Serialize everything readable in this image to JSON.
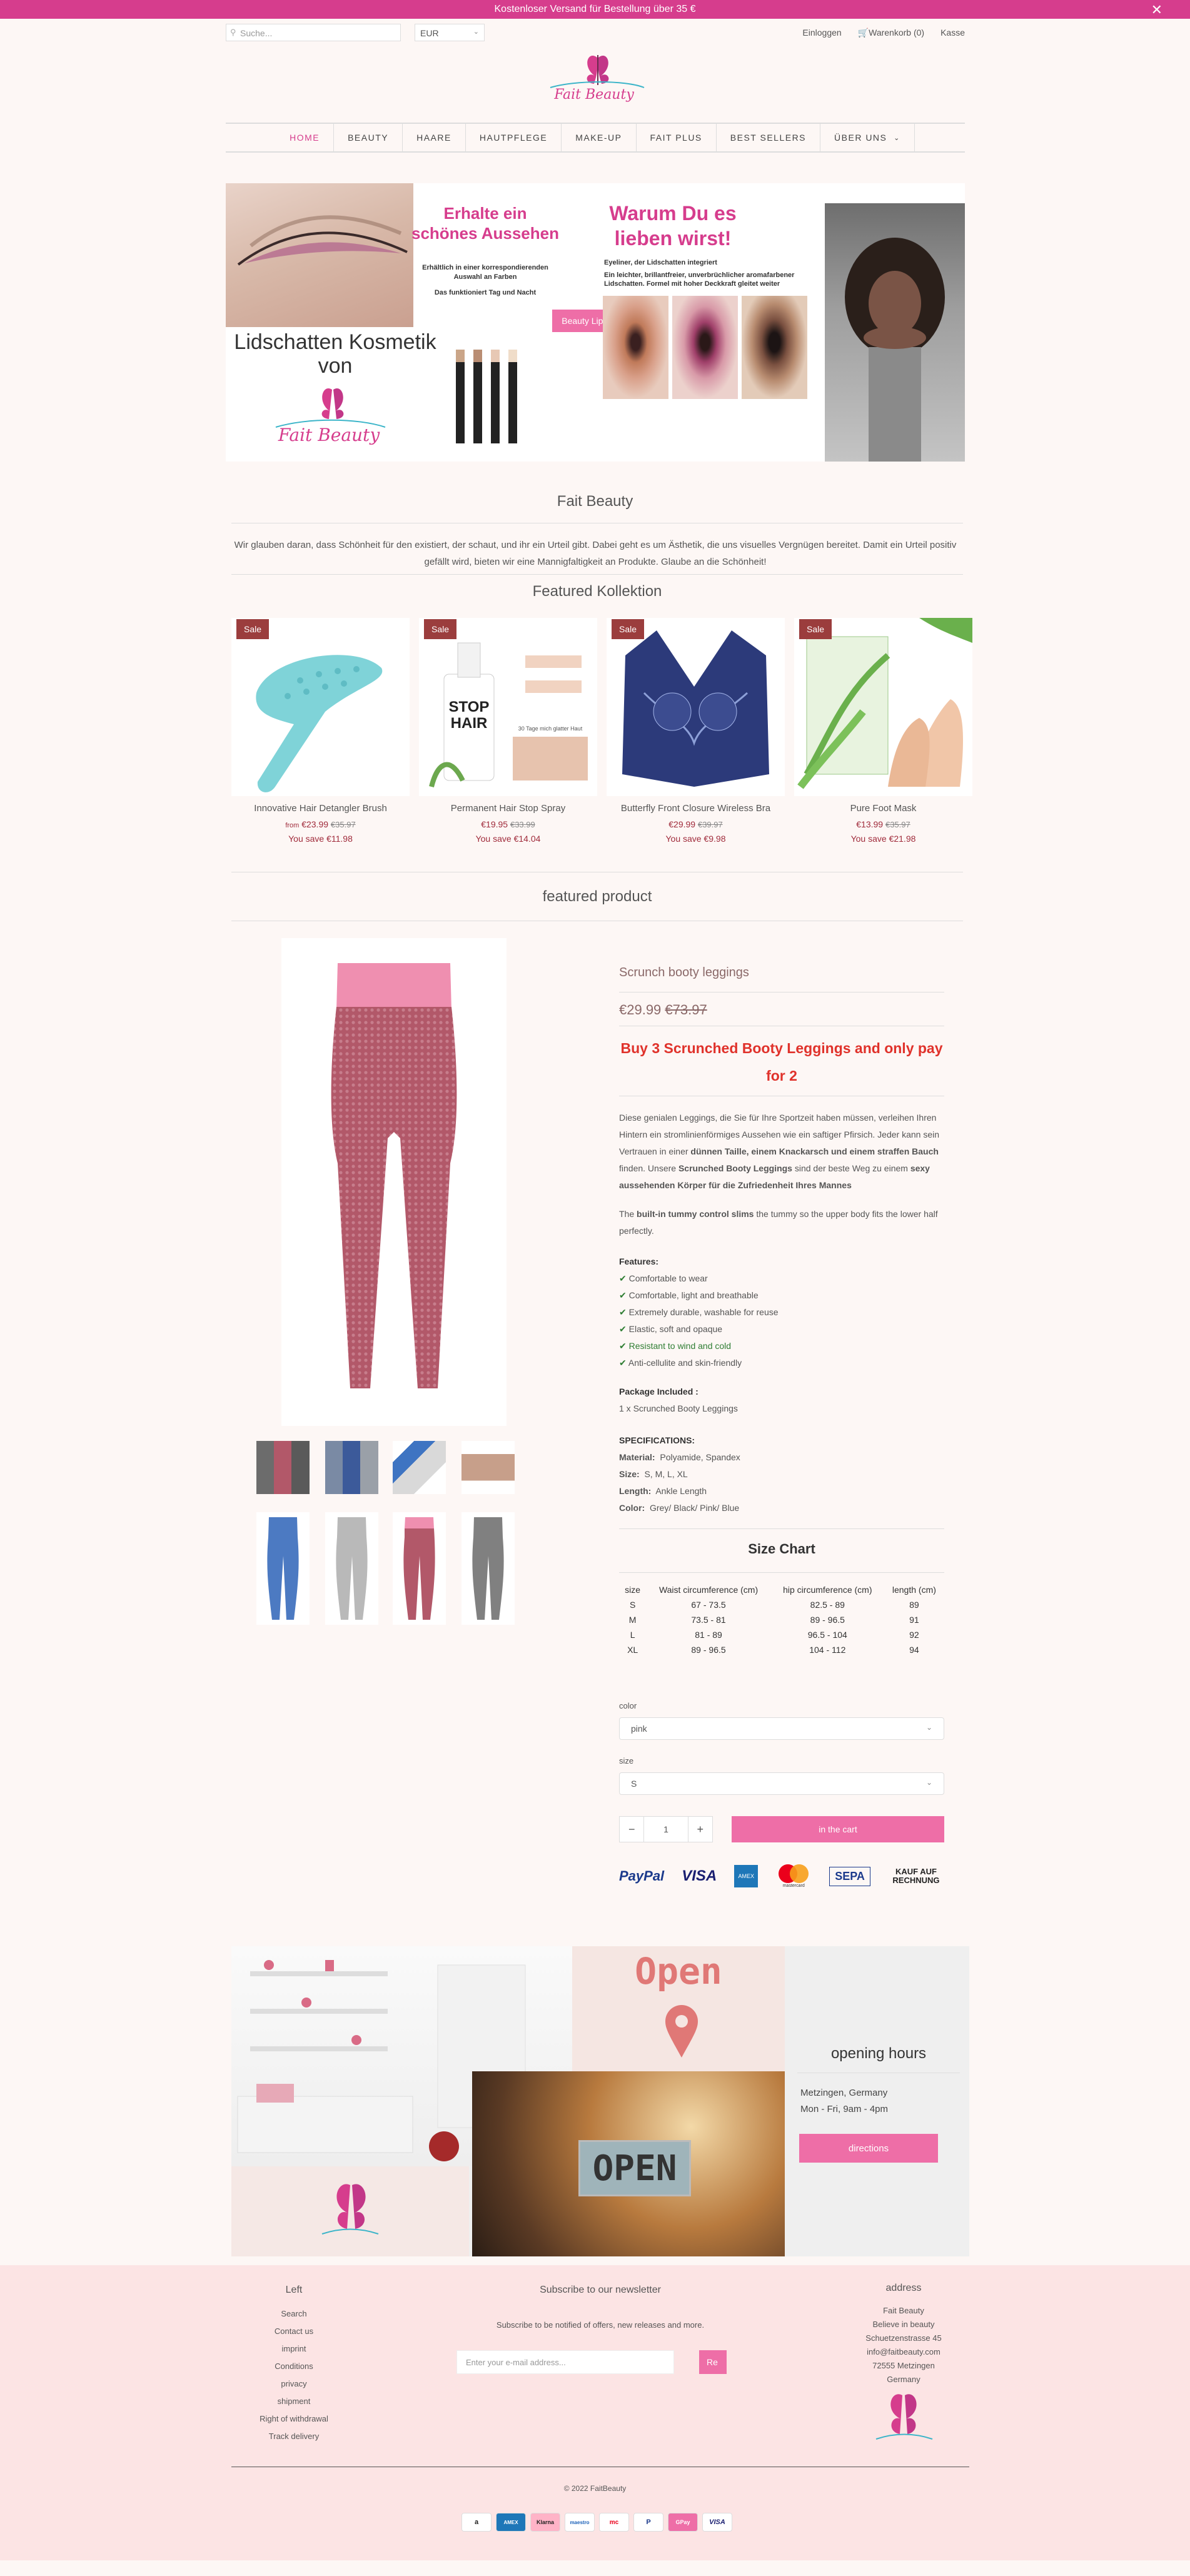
{
  "announcement": "Kostenloser Versand für Bestellung über 35 €",
  "search": {
    "placeholder": "Suche..."
  },
  "currency": "EUR",
  "toplinks": {
    "login": "Einloggen",
    "cart": "Warenkorb (0)",
    "checkout": "Kasse"
  },
  "logo": "Fait Beauty",
  "nav": [
    "HOME",
    "BEAUTY",
    "HAARE",
    "HAUTPFLEGE",
    "MAKE-UP",
    "FAIT PLUS",
    "BEST SELLERS",
    "ÜBER UNS"
  ],
  "banner": {
    "h1": "Erhalte ein",
    "h2": "schönes Aussehen",
    "sub1": "Erhältlich in einer korrespondierenden",
    "sub2": "Auswahl an Farben",
    "sub3": "Das funktioniert Tag und Nacht",
    "lid1": "Lidschatten Kosmetik",
    "lid2": "von",
    "w1": "Warum Du es",
    "w2": "lieben wirst!",
    "d1": "Eyeliner, der Lidschatten integriert",
    "d2": "Ein leichter, brillantfreier, unverbrüchlicher aromafarbener",
    "d3": "Lidschatten. Formel mit hoher Deckkraft gleitet weiter",
    "button": "Beauty Lippen"
  },
  "about": {
    "title": "Fait Beauty",
    "text1": "Wir glauben daran, dass Schönheit für den existiert, der schaut, und ihr ein Urteil gibt. Dabei geht es um Ästhetik, die uns visuelles Vergnügen bereitet. Damit ein Urteil positiv",
    "text2": "gefällt wird, bieten wir eine Mannigfaltigkeit an Produkte. Glaube an die Schönheit!"
  },
  "featured_title": "Featured Kollektion",
  "products": [
    {
      "sale": "Sale",
      "name": "Innovative Hair Detangler Brush",
      "from": "from",
      "price": "€23.99",
      "old": "€35.97",
      "save": "You save €11.98"
    },
    {
      "sale": "Sale",
      "name": "Permanent Hair Stop Spray",
      "from": "",
      "price": "€19.95",
      "old": "€33.99",
      "save": "You save €14.04"
    },
    {
      "sale": "Sale",
      "name": "Butterfly Front Closure Wireless Bra",
      "from": "",
      "price": "€29.99",
      "old": "€39.97",
      "save": "You save €9.98"
    },
    {
      "sale": "Sale",
      "name": "Pure Foot Mask",
      "from": "",
      "price": "€13.99",
      "old": "€35.97",
      "save": "You save €21.98"
    }
  ],
  "spray_text": "STOP HAIR",
  "spray_note": "30 Tage mich glatter Haut",
  "fp": {
    "section_title": "featured product",
    "name": "Scrunch booty leggings",
    "price": "€29.99",
    "old": "€73.97",
    "promo": "Buy 3 Scrunched Booty Leggings and only pay for 2",
    "p1": "Diese genialen Leggings, die Sie für Ihre Sportzeit haben müssen, verleihen Ihren Hintern ein stromlinienförmiges Aussehen wie ein saftiger Pfirsich. Jeder kann sein Vertrauen in einer",
    "p1b": "dünnen Taille, einem Knackarsch und einem straffen Bauch",
    "p1c": "finden. Unsere",
    "p1d": "Scrunched Booty Leggings",
    "p1e": "sind der beste Weg zu einem",
    "p1f": "sexy aussehenden Körper für die Zufriedenheit Ihres Mannes",
    "p2a": "The",
    "p2b": "built-in tummy control slims",
    "p2c": "the tummy so the upper body fits the lower half perfectly.",
    "features_label": "Features:",
    "features": [
      "Comfortable  to wear",
      "Comfortable, light and breathable",
      "Extremely durable, washable for reuse",
      "Elastic, soft and opaque",
      "Resistant to  wind and cold",
      "Anti-cellulite and skin-friendly"
    ],
    "pkg_label": "Package Included :",
    "pkg": "1 x Scrunched Booty Leggings",
    "spec_label": "SPECIFICATIONS:",
    "specs": [
      {
        "k": "Material:",
        "v": "Polyamide, Spandex"
      },
      {
        "k": "Size:",
        "v": "S, M, L, XL"
      },
      {
        "k": "Length:",
        "v": "Ankle Length"
      },
      {
        "k": "Color:",
        "v": "Grey/ Black/ Pink/ Blue"
      }
    ],
    "size_chart_title": "Size Chart",
    "size_head": [
      "size",
      "Waist circumference (cm)",
      "hip circumference (cm)",
      "length (cm)"
    ],
    "size_rows": [
      [
        "S",
        "67 - 73.5",
        "82.5 - 89",
        "89"
      ],
      [
        "M",
        "73.5 - 81",
        "89 - 96.5",
        "91"
      ],
      [
        "L",
        "81 - 89",
        "96.5 - 104",
        "92"
      ],
      [
        "XL",
        "89 - 96.5",
        "104 - 112",
        "94"
      ]
    ],
    "color_label": "color",
    "color_value": "pink",
    "size_label": "size",
    "size_value": "S",
    "qty": "1",
    "minus": "−",
    "plus": "+",
    "cart_button": "in the cart",
    "pay": [
      "PayPal",
      "VISA",
      "AMEX",
      "mastercard",
      "SEPA",
      "KAUF AUF RECHNUNG"
    ]
  },
  "store": {
    "open_sign": "Open",
    "open_door": "OPEN",
    "title": "opening hours",
    "loc": "Metzingen, Germany",
    "hours": "Mon - Fri, 9am - 4pm",
    "button": "directions"
  },
  "footer": {
    "left_title": "Left",
    "links": [
      "Search",
      "Contact us",
      "imprint",
      "Conditions",
      "privacy",
      "shipment",
      "Right of withdrawal",
      "Track delivery"
    ],
    "news_title": "Subscribe to our newsletter",
    "news_text": "Subscribe to be notified of offers, new releases and more.",
    "email_placeholder": "Enter your e-mail address...",
    "subscribe": "Re",
    "addr_title": "address",
    "addr": [
      "Fait Beauty",
      "Believe in beauty",
      "Schuetzenstrasse 45",
      "info@faitbeauty.com",
      "72555 Metzingen",
      "Germany"
    ],
    "copyright": "© 2022 FaitBeauty",
    "pay": [
      "a",
      "AMEX",
      "Klarna",
      "maestro",
      "mc",
      "P",
      "GPay",
      "VISA"
    ]
  },
  "colors": {
    "brand": "#d63d8d",
    "sale": "#9b3d3d",
    "price": "#a02b3b",
    "promo": "#e0322b"
  }
}
